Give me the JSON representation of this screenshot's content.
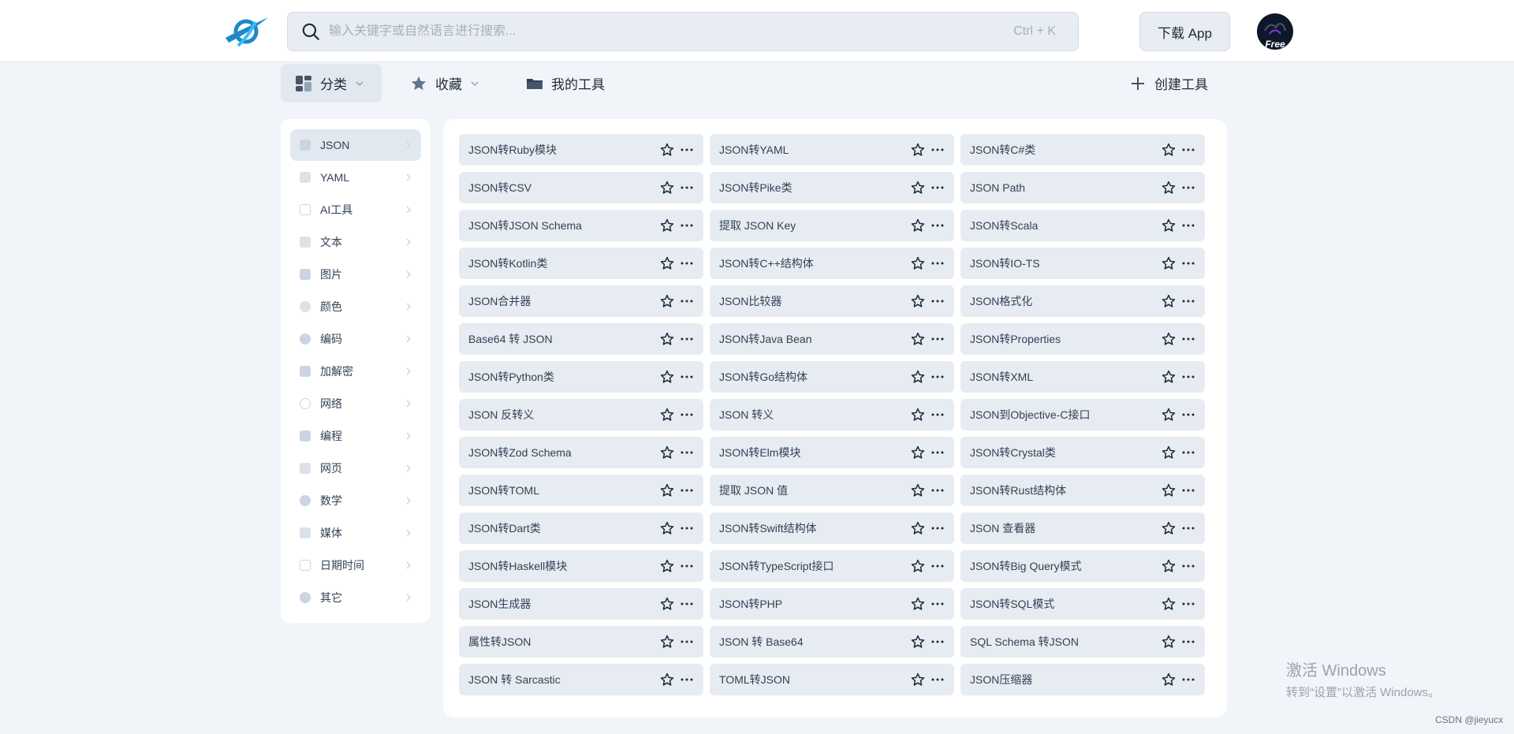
{
  "header": {
    "search_placeholder": "输入关键字或自然语言进行搜索...",
    "shortcut": "Ctrl + K",
    "download_label": "下载 App",
    "avatar_badge": "Free"
  },
  "toolbar": {
    "category_label": "分类",
    "favorites_label": "收藏",
    "my_tools_label": "我的工具",
    "create_label": "创建工具"
  },
  "sidebar": {
    "items": [
      {
        "label": "JSON",
        "icon": "json-file-icon",
        "active": true
      },
      {
        "label": "YAML",
        "icon": "yaml-file-icon"
      },
      {
        "label": "AI工具",
        "icon": "ai-icon"
      },
      {
        "label": "文本",
        "icon": "text-icon"
      },
      {
        "label": "图片",
        "icon": "image-icon"
      },
      {
        "label": "颜色",
        "icon": "palette-icon"
      },
      {
        "label": "编码",
        "icon": "encoding-icon"
      },
      {
        "label": "加解密",
        "icon": "encryption-icon"
      },
      {
        "label": "网络",
        "icon": "network-icon"
      },
      {
        "label": "编程",
        "icon": "programming-icon"
      },
      {
        "label": "网页",
        "icon": "webpage-icon"
      },
      {
        "label": "数学",
        "icon": "math-icon"
      },
      {
        "label": "媒体",
        "icon": "media-icon"
      },
      {
        "label": "日期时间",
        "icon": "calendar-icon"
      },
      {
        "label": "其它",
        "icon": "other-icon"
      }
    ]
  },
  "tools": [
    "JSON转Ruby模块",
    "JSON转YAML",
    "JSON转C#类",
    "JSON转CSV",
    "JSON转Pike类",
    "JSON Path",
    "JSON转JSON Schema",
    "提取 JSON Key",
    "JSON转Scala",
    "JSON转Kotlin类",
    "JSON转C++结构体",
    "JSON转IO-TS",
    "JSON合并器",
    "JSON比较器",
    "JSON格式化",
    "Base64 转 JSON",
    "JSON转Java Bean",
    "JSON转Properties",
    "JSON转Python类",
    "JSON转Go结构体",
    "JSON转XML",
    "JSON 反转义",
    "JSON 转义",
    "JSON到Objective-C接口",
    "JSON转Zod Schema",
    "JSON转Elm模块",
    "JSON转Crystal类",
    "JSON转TOML",
    "提取 JSON 值",
    "JSON转Rust结构体",
    "JSON转Dart类",
    "JSON转Swift结构体",
    "JSON 查看器",
    "JSON转Haskell模块",
    "JSON转TypeScript接口",
    "JSON转Big Query模式",
    "JSON生成器",
    "JSON转PHP",
    "JSON转SQL模式",
    "属性转JSON",
    "JSON 转 Base64",
    "SQL Schema 转JSON",
    "JSON 转 Sarcastic",
    "TOML转JSON",
    "JSON压缩器"
  ],
  "watermark": {
    "title": "激活 Windows",
    "subtitle": "转到“设置”以激活 Windows。"
  },
  "credit": "CSDN @jieyucx"
}
